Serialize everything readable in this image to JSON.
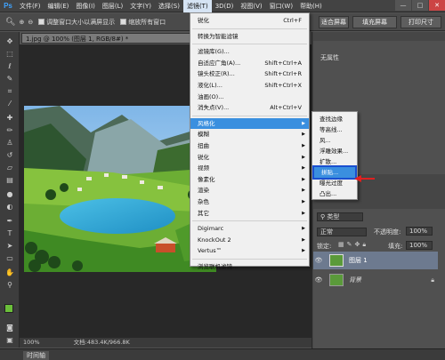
{
  "app": {
    "logo": "Ps"
  },
  "menubar": {
    "items": [
      "文件(F)",
      "编辑(E)",
      "图像(I)",
      "图层(L)",
      "文字(Y)",
      "选择(S)",
      "滤镜(T)",
      "3D(D)",
      "视图(V)",
      "窗口(W)",
      "帮助(H)"
    ],
    "active_index": 6,
    "window_buttons": [
      "—",
      "□",
      "✕"
    ]
  },
  "options_bar": {
    "resize_label": "调整窗口大小以满屏显示",
    "zoom_all_label": "缩放所有窗口",
    "fill_screen": "填充屏幕",
    "print_size": "打印尺寸",
    "screen_fit": "适合屏幕"
  },
  "document": {
    "tab_title": "1.jpg @ 100% (图层 1, RGB/8#) *",
    "tab_close": "×",
    "zoom": "100%",
    "doc_info": "文档:483.4K/966.8K"
  },
  "timeline": {
    "label": "时间轴"
  },
  "filter_menu": {
    "items": [
      {
        "label": "锐化",
        "shortcut": "Ctrl+F",
        "group": 0
      },
      {
        "label": "转换为智能滤镜",
        "shortcut": "",
        "group": 1
      },
      {
        "label": "滤镜库(G)...",
        "shortcut": "",
        "group": 2
      },
      {
        "label": "自适应广角(A)...",
        "shortcut": "Shift+Ctrl+A",
        "group": 2
      },
      {
        "label": "镜头校正(R)...",
        "shortcut": "Shift+Ctrl+R",
        "group": 2
      },
      {
        "label": "液化(L)...",
        "shortcut": "Shift+Ctrl+X",
        "group": 2
      },
      {
        "label": "油画(O)...",
        "shortcut": "",
        "group": 2
      },
      {
        "label": "消失点(V)...",
        "shortcut": "Alt+Ctrl+V",
        "group": 2
      },
      {
        "label": "风格化",
        "shortcut": "",
        "group": 3,
        "submenu": true,
        "highlighted": true
      },
      {
        "label": "模糊",
        "shortcut": "",
        "group": 3,
        "submenu": true
      },
      {
        "label": "扭曲",
        "shortcut": "",
        "group": 3,
        "submenu": true
      },
      {
        "label": "锐化",
        "shortcut": "",
        "group": 3,
        "submenu": true
      },
      {
        "label": "视频",
        "shortcut": "",
        "group": 3,
        "submenu": true
      },
      {
        "label": "像素化",
        "shortcut": "",
        "group": 3,
        "submenu": true
      },
      {
        "label": "渲染",
        "shortcut": "",
        "group": 3,
        "submenu": true
      },
      {
        "label": "杂色",
        "shortcut": "",
        "group": 3,
        "submenu": true
      },
      {
        "label": "其它",
        "shortcut": "",
        "group": 3,
        "submenu": true
      },
      {
        "label": "Digimarc",
        "shortcut": "",
        "group": 4,
        "submenu": true
      },
      {
        "label": "KnockOut 2",
        "shortcut": "",
        "group": 4,
        "submenu": true
      },
      {
        "label": "Vertus™",
        "shortcut": "",
        "group": 4,
        "submenu": true
      },
      {
        "label": "浏览联机滤镜...",
        "shortcut": "",
        "group": 5
      }
    ]
  },
  "stylize_submenu": {
    "items": [
      {
        "label": "查找边缘"
      },
      {
        "label": "等高线..."
      },
      {
        "label": "风..."
      },
      {
        "label": "浮雕效果..."
      },
      {
        "label": "扩散..."
      },
      {
        "label": "拼贴...",
        "highlighted": true
      },
      {
        "label": "曝光过度"
      },
      {
        "label": "凸出..."
      }
    ]
  },
  "properties_panel": {
    "tab": "属性",
    "content": "无属性"
  },
  "layers_panel": {
    "kind_label": "类型",
    "blend_mode": "正常",
    "opacity_label": "不透明度:",
    "opacity_value": "100%",
    "lock_label": "锁定:",
    "fill_label": "填充:",
    "fill_value": "100%",
    "layers": [
      {
        "name": "图层 1",
        "selected": true
      },
      {
        "name": "背景",
        "italic": true,
        "locked": true
      }
    ]
  },
  "colors": {
    "foreground": "#6bbf3a",
    "background": "#ffffff",
    "highlight": "#3a8fdf",
    "arrow": "#e02020"
  }
}
